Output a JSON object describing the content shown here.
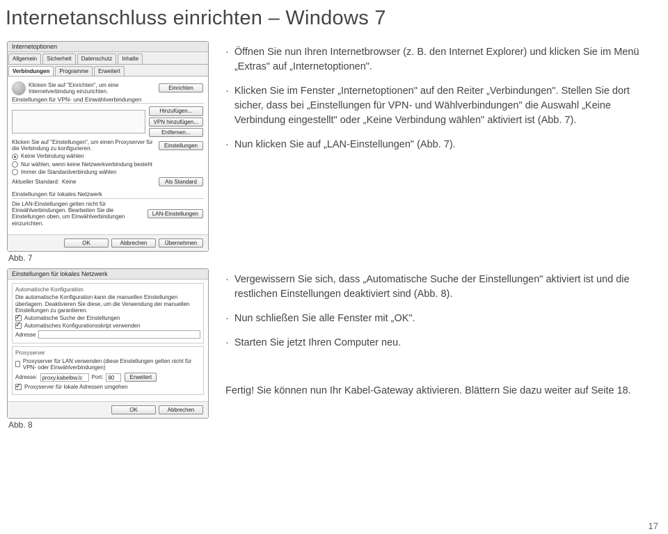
{
  "page_title": "Internetanschluss einrichten – Windows 7",
  "page_number": "17",
  "captions": {
    "abb7": "Abb. 7",
    "abb8": "Abb. 8"
  },
  "instructions_top": [
    "Öffnen Sie nun Ihren Internetbrowser (z. B. den Internet Explorer) und klicken Sie im Menü „Extras\" auf „Internetoptionen\".",
    "Klicken Sie im Fenster „Internetoptionen\" auf den Reiter „Verbindungen\". Stellen Sie dort sicher, dass bei „Einstellungen für VPN- und Wählverbindungen\" die Auswahl „Keine Verbindung eingestellt\" oder „Keine Verbindung wählen\" aktiviert ist (Abb. 7).",
    "Nun klicken Sie auf „LAN-Einstellungen\" (Abb. 7)."
  ],
  "instructions_bottom": [
    "Vergewissern Sie sich, dass „Automatische Suche der Einstellungen\" aktiviert ist und die restlichen Einstellungen deaktiviert sind (Abb. 8).",
    "Nun schließen Sie alle Fenster mit „OK\".",
    "Starten Sie jetzt Ihren Computer neu."
  ],
  "final_note": "Fertig! Sie können nun Ihr Kabel-Gateway aktivieren. Blättern Sie dazu weiter auf Seite 18.",
  "dialog_inetopt": {
    "title": "Internetoptionen",
    "tabs_row1": [
      "Allgemein",
      "Sicherheit",
      "Datenschutz",
      "Inhalte"
    ],
    "tabs_row2": [
      "Verbindungen",
      "Programme",
      "Erweitert"
    ],
    "setup_hint": "Klicken Sie auf \"Einrichten\", um eine Internetverbindung einzurichten.",
    "setup_btn": "Einrichten",
    "vpn_title": "Einstellungen für VPN- und Einwählverbindungen",
    "btn_add": "Hinzufügen...",
    "btn_vpn": "VPN hinzufügen...",
    "btn_remove": "Entfernen...",
    "proxy_hint": "Klicken Sie auf \"Einstellungen\", um einen Proxyserver für die Verbindung zu konfigurieren.",
    "btn_settings": "Einstellungen",
    "radio1": "Keine Verbindung wählen",
    "radio2": "Nur wählen, wenn keine Netzwerkverbindung besteht",
    "radio3": "Immer die Standardverbindung wählen",
    "default_label": "Aktueller Standard:",
    "default_value": "Keine",
    "btn_default": "Als Standard",
    "lan_title": "Einstellungen für lokales Netzwerk",
    "lan_hint": "Die LAN-Einstellungen gelten nicht für Einwählverbindungen. Bearbeiten Sie die Einstellungen oben, um Einwählverbindungen einzurichten.",
    "btn_lan": "LAN-Einstellungen",
    "btn_ok": "OK",
    "btn_cancel": "Abbrechen",
    "btn_apply": "Übernehmen"
  },
  "dialog_lan": {
    "title": "Einstellungen für lokales Netzwerk",
    "auto_frame": "Automatische Konfiguration",
    "auto_hint": "Die automatische Konfiguration kann die manuellen Einstellungen überlagern. Deaktivieren Sie diese, um die Verwendung der manuellen Einstellungen zu garantieren.",
    "chk_auto": "Automatische Suche der Einstellungen",
    "chk_script": "Automatisches Konfigurationsskript verwenden",
    "addr_label": "Adresse",
    "proxy_frame": "Proxyserver",
    "chk_proxy": "Proxyserver für LAN verwenden (diese Einstellungen gelten nicht für VPN- oder Einwählverbindungen)",
    "addr2_label": "Adresse:",
    "addr2_value": "proxy.kabelbw.lc",
    "port_label": "Port:",
    "port_value": "80",
    "btn_adv": "Erweitert",
    "chk_bypass": "Proxyserver für lokale Adressen umgehen",
    "btn_ok": "OK",
    "btn_cancel": "Abbrechen"
  }
}
